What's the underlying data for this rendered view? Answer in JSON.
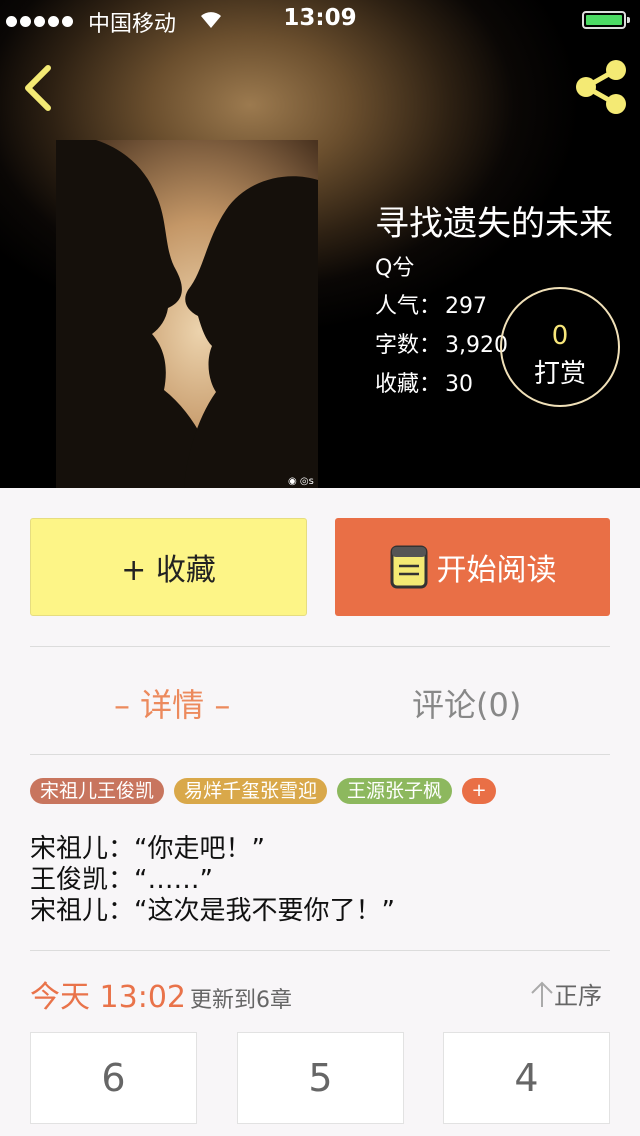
{
  "status_bar": {
    "carrier": "中国移动",
    "time": "13:09"
  },
  "book": {
    "title": "寻找遗失的未来",
    "author": "Q兮",
    "stats": [
      {
        "label": "人气：",
        "value": "297"
      },
      {
        "label": "字数：",
        "value": "3,920"
      },
      {
        "label": "收藏：",
        "value": "30"
      }
    ],
    "reward_count": "0",
    "reward_label": "打赏"
  },
  "actions": {
    "collect_label": "+ 收藏",
    "read_label": "开始阅读"
  },
  "tabs": {
    "details": "– 详情 –",
    "comments": "评论(0)"
  },
  "tags": [
    {
      "label": "宋祖儿王俊凯",
      "color": "#c8755e"
    },
    {
      "label": "易烊千玺张雪迎",
      "color": "#d9a84a"
    },
    {
      "label": "王源张子枫",
      "color": "#8db85e"
    }
  ],
  "tag_add": "+",
  "tag_add_color": "#e96f46",
  "intro_lines": [
    "宋祖儿：“你走吧！”",
    "王俊凯：“……”",
    "宋祖儿：“这次是我不要你了！”"
  ],
  "update": {
    "time": "今天 13:02",
    "message": "更新到6章",
    "order_label": "正序"
  },
  "chapters": [
    "6",
    "5",
    "4"
  ],
  "colors": {
    "accent": "#e96f46",
    "collect": "#fdf587",
    "tab_active": "#ec8a5d",
    "icon_yellow": "#f4ea74"
  }
}
